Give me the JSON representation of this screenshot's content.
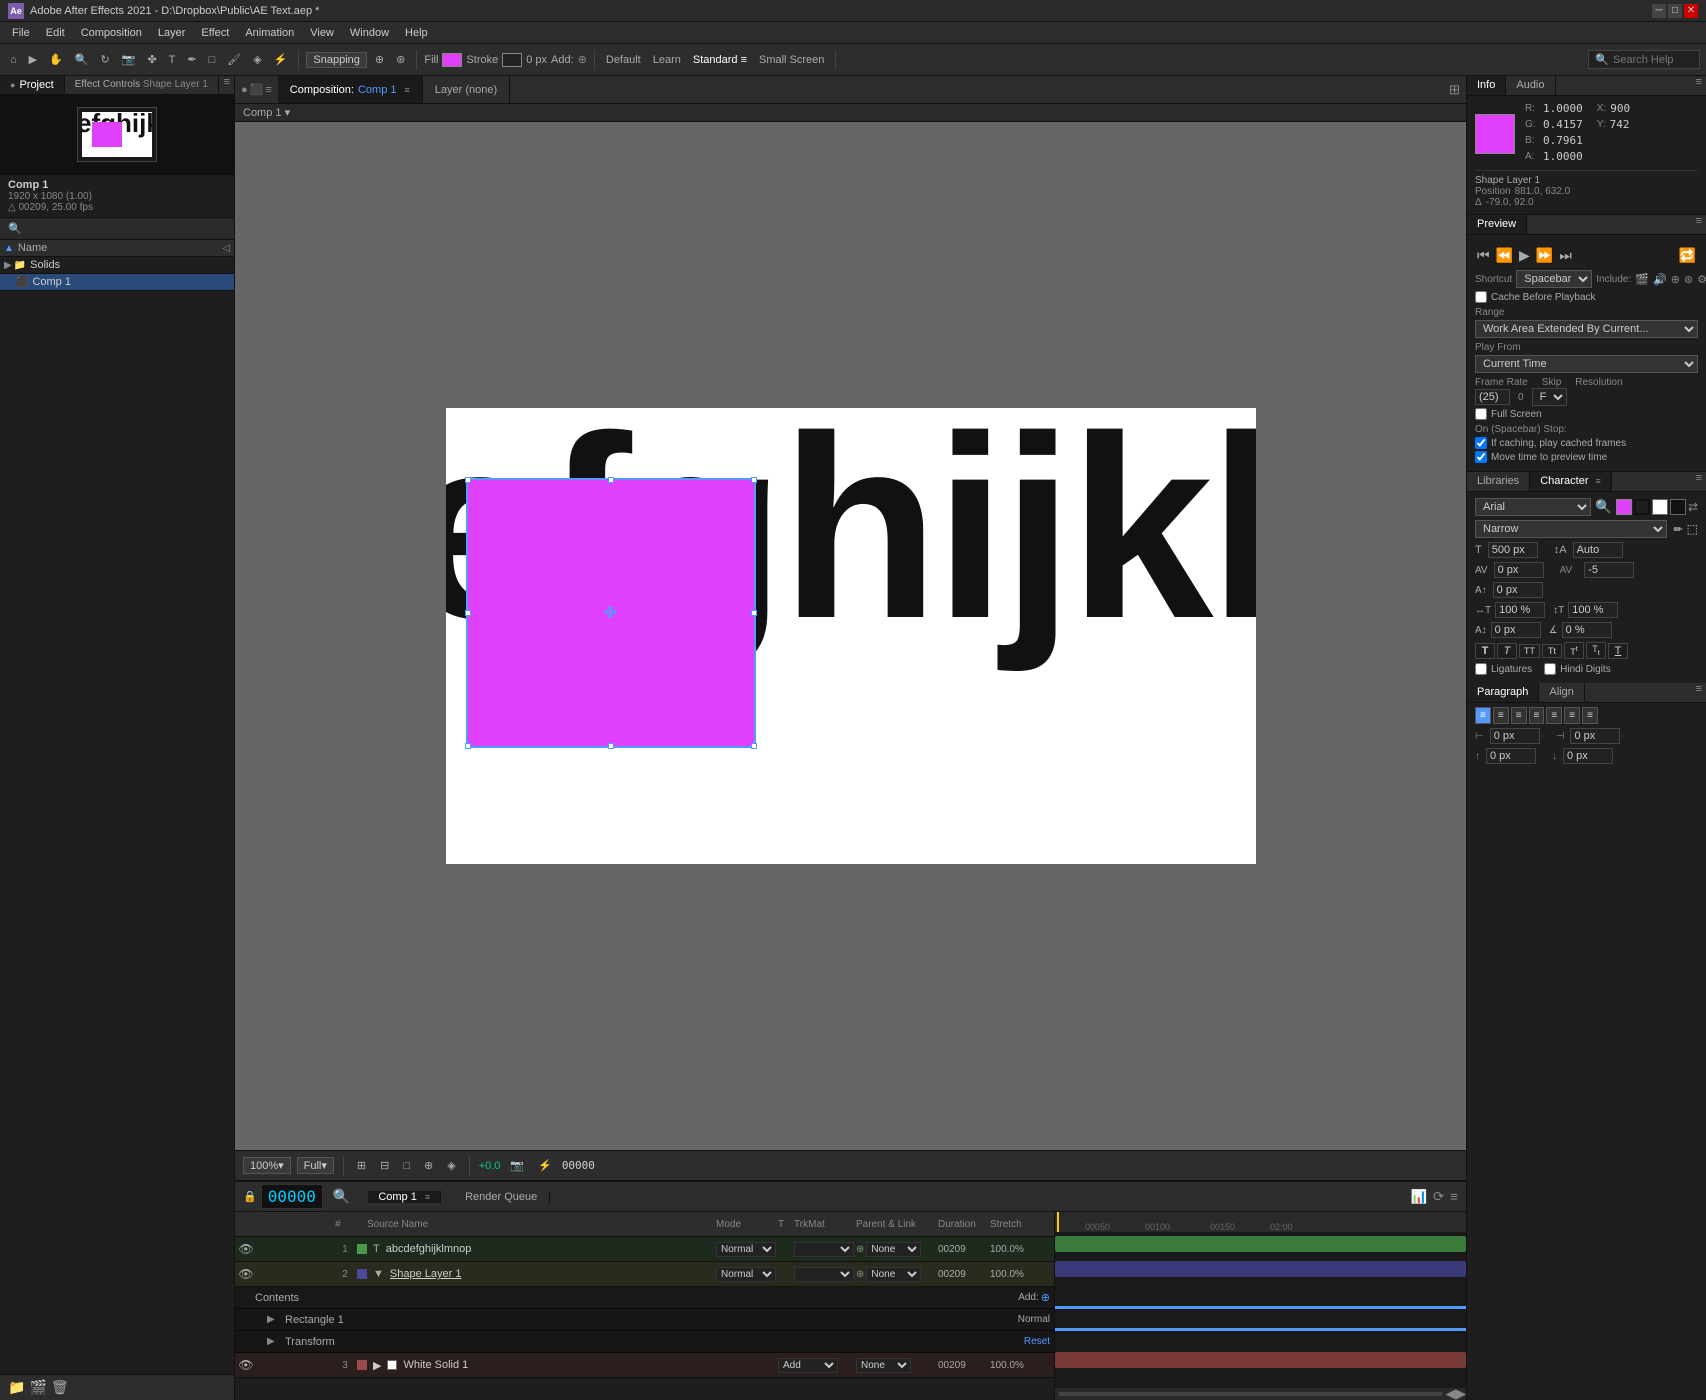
{
  "app": {
    "title": "Adobe After Effects 2021 - D:\\Dropbox\\Public\\AE Text.aep *",
    "icon": "AE"
  },
  "menubar": {
    "items": [
      "File",
      "Edit",
      "Composition",
      "Layer",
      "Effect",
      "Animation",
      "View",
      "Window",
      "Help"
    ]
  },
  "toolbar": {
    "snapping": "Snapping",
    "fill_label": "Fill",
    "stroke_label": "Stroke",
    "px_label": "0 px",
    "add_label": "Add:",
    "default_btn": "Default",
    "learn_btn": "Learn",
    "standard_btn": "Standard",
    "small_screen_btn": "Small Screen",
    "search_placeholder": "Search Help"
  },
  "project_panel": {
    "title": "Project",
    "tab1": "Project",
    "tab2": "Effect Controls",
    "tab2_sub": "Shape Layer 1",
    "comp_name": "Comp 1",
    "comp_res": "1920 x 1080 (1.00)",
    "comp_fps": "△ 00209, 25.00 fps",
    "search_placeholder": "Search",
    "layers": {
      "header": "Name",
      "items": [
        {
          "name": "Solids",
          "type": "folder",
          "color": "#444"
        },
        {
          "name": "Comp 1",
          "type": "comp",
          "color": "#5599ff",
          "selected": true
        }
      ]
    }
  },
  "composition": {
    "name": "Comp 1",
    "tab_label": "Composition: Comp 1",
    "layer_label": "Layer (none)",
    "breadcrumb": "Comp 1 ▾"
  },
  "canvas": {
    "zoom": "100%",
    "resolution": "Full",
    "timecode": "00000",
    "text_content": "efghijklr",
    "shape_color": "#e040fb"
  },
  "info_panel": {
    "tab": "Info",
    "audio_tab": "Audio",
    "r_label": "R",
    "g_label": "G",
    "b_label": "B",
    "a_label": "A",
    "r_val": "1.0000",
    "g_val": "0.4157",
    "b_val": "0.7961",
    "a_val": "1.0000",
    "x_label": "X",
    "y_label": "Y",
    "x_val": "900",
    "y_val": "742",
    "shape_info": "Shape Layer 1",
    "position_label": "Position",
    "position_val": "881.0, 632.0",
    "delta_label": "Δ",
    "delta_val": "-79.0, 92.0"
  },
  "preview_panel": {
    "tab": "Preview",
    "shortcut_label": "Shortcut",
    "shortcut_val": "Spacebar",
    "include_label": "Include:",
    "cache_label": "Cache Before Playback",
    "range_label": "Range",
    "range_val": "Work Area Extended By Current...",
    "play_from_label": "Play From",
    "play_from_val": "Current Time",
    "frame_rate_label": "Frame Rate",
    "skip_label": "Skip",
    "resolution_label": "Resolution",
    "fps_val": "(25)",
    "skip_val": "0",
    "res_val": "Full",
    "full_screen_label": "Full Screen",
    "on_spacebar_label": "On (Spacebar) Stop:",
    "if_caching_label": "If caching, play cached frames",
    "move_time_label": "Move time to preview time"
  },
  "character_panel": {
    "tab": "Character",
    "libraries_tab": "Libraries",
    "font_name": "Arial",
    "font_style": "Narrow",
    "size_val": "500 px",
    "leading_val": "Auto",
    "tracking_val": "-5",
    "tsb_val": "0 px",
    "horiz_scale": "100 %",
    "vert_scale": "100 %",
    "baseline_shift": "0 %",
    "stroke_width": "0 px",
    "ligatures_label": "Ligatures",
    "hindi_label": "Hindi Digits",
    "format_buttons": [
      "T",
      "T",
      "T",
      "T",
      "T",
      "T",
      "T"
    ]
  },
  "paragraph_panel": {
    "tab": "Paragraph",
    "align_tab": "Align"
  },
  "timeline": {
    "timecode": "00000",
    "comp_name": "Comp 1",
    "render_queue": "Render Queue",
    "layers": [
      {
        "num": "1",
        "color": "#4a9a4a",
        "type": "T",
        "name": "abcdefghijklmnop",
        "mode": "Normal",
        "trkmat": "",
        "parent": "None",
        "duration": "00209",
        "stretch": "100.0%"
      },
      {
        "num": "2",
        "color": "#4a4a9a",
        "type": "",
        "name": "Shape Layer 1",
        "mode": "Normal",
        "trkmat": "",
        "parent": "None",
        "duration": "00209",
        "stretch": "100.0%",
        "expanded": true,
        "children": [
          {
            "name": "Contents",
            "add": "Add:"
          },
          {
            "name": "Rectangle 1",
            "mode": "Normal"
          },
          {
            "name": "Transform",
            "action": "Reset"
          }
        ]
      },
      {
        "num": "3",
        "color": "#9a4a4a",
        "type": "",
        "name": "White Solid 1",
        "mode": "Add",
        "parent": "None",
        "duration": "00209",
        "stretch": "100.0%"
      }
    ],
    "ruler_marks": [
      "00050",
      "00100",
      "00150",
      "02:00"
    ]
  }
}
